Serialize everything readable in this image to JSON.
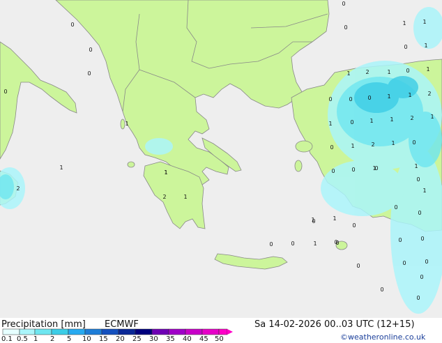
{
  "product": {
    "title": "Precipitation [mm]",
    "model": "ECMWF",
    "valid_time": "Sa 14-02-2026 00..03 UTC (12+15)",
    "credit": "©weatheronline.co.uk"
  },
  "legend": {
    "ticks": [
      "0.1",
      "0.5",
      "1",
      "2",
      "5",
      "10",
      "15",
      "20",
      "25",
      "30",
      "35",
      "40",
      "45",
      "50"
    ],
    "colors": [
      "#e6ffff",
      "#aaf5fa",
      "#6ee6f0",
      "#3ccde6",
      "#28aaf0",
      "#1e7dd7",
      "#1450be",
      "#0a2896",
      "#00007d",
      "#6e00b4",
      "#a000c8",
      "#c800c8",
      "#e600c8",
      "#ff00c8"
    ]
  },
  "map_colors": {
    "sea": "#eeeeee",
    "land": "#ccf59b",
    "border": "#888888"
  },
  "point_values": [
    "0",
    "0",
    "0",
    "0",
    "1",
    "1",
    "0",
    "1",
    "1",
    "2",
    "0",
    "1",
    "0",
    "1",
    "0",
    "0",
    "0",
    "0",
    "1",
    "1",
    "2",
    "1",
    "1",
    "0",
    "1",
    "1",
    "2",
    "1",
    "0",
    "1",
    "2",
    "1",
    "0",
    "1",
    "0",
    "1",
    "1",
    "0",
    "1",
    "2",
    "1",
    "2",
    "1",
    "0",
    "1",
    "1",
    "0",
    "0",
    "0",
    "0",
    "1",
    "0",
    "0",
    "0",
    "0",
    "0",
    "0",
    "0",
    "0",
    "0",
    "0",
    "0",
    "0",
    "0",
    "1"
  ]
}
